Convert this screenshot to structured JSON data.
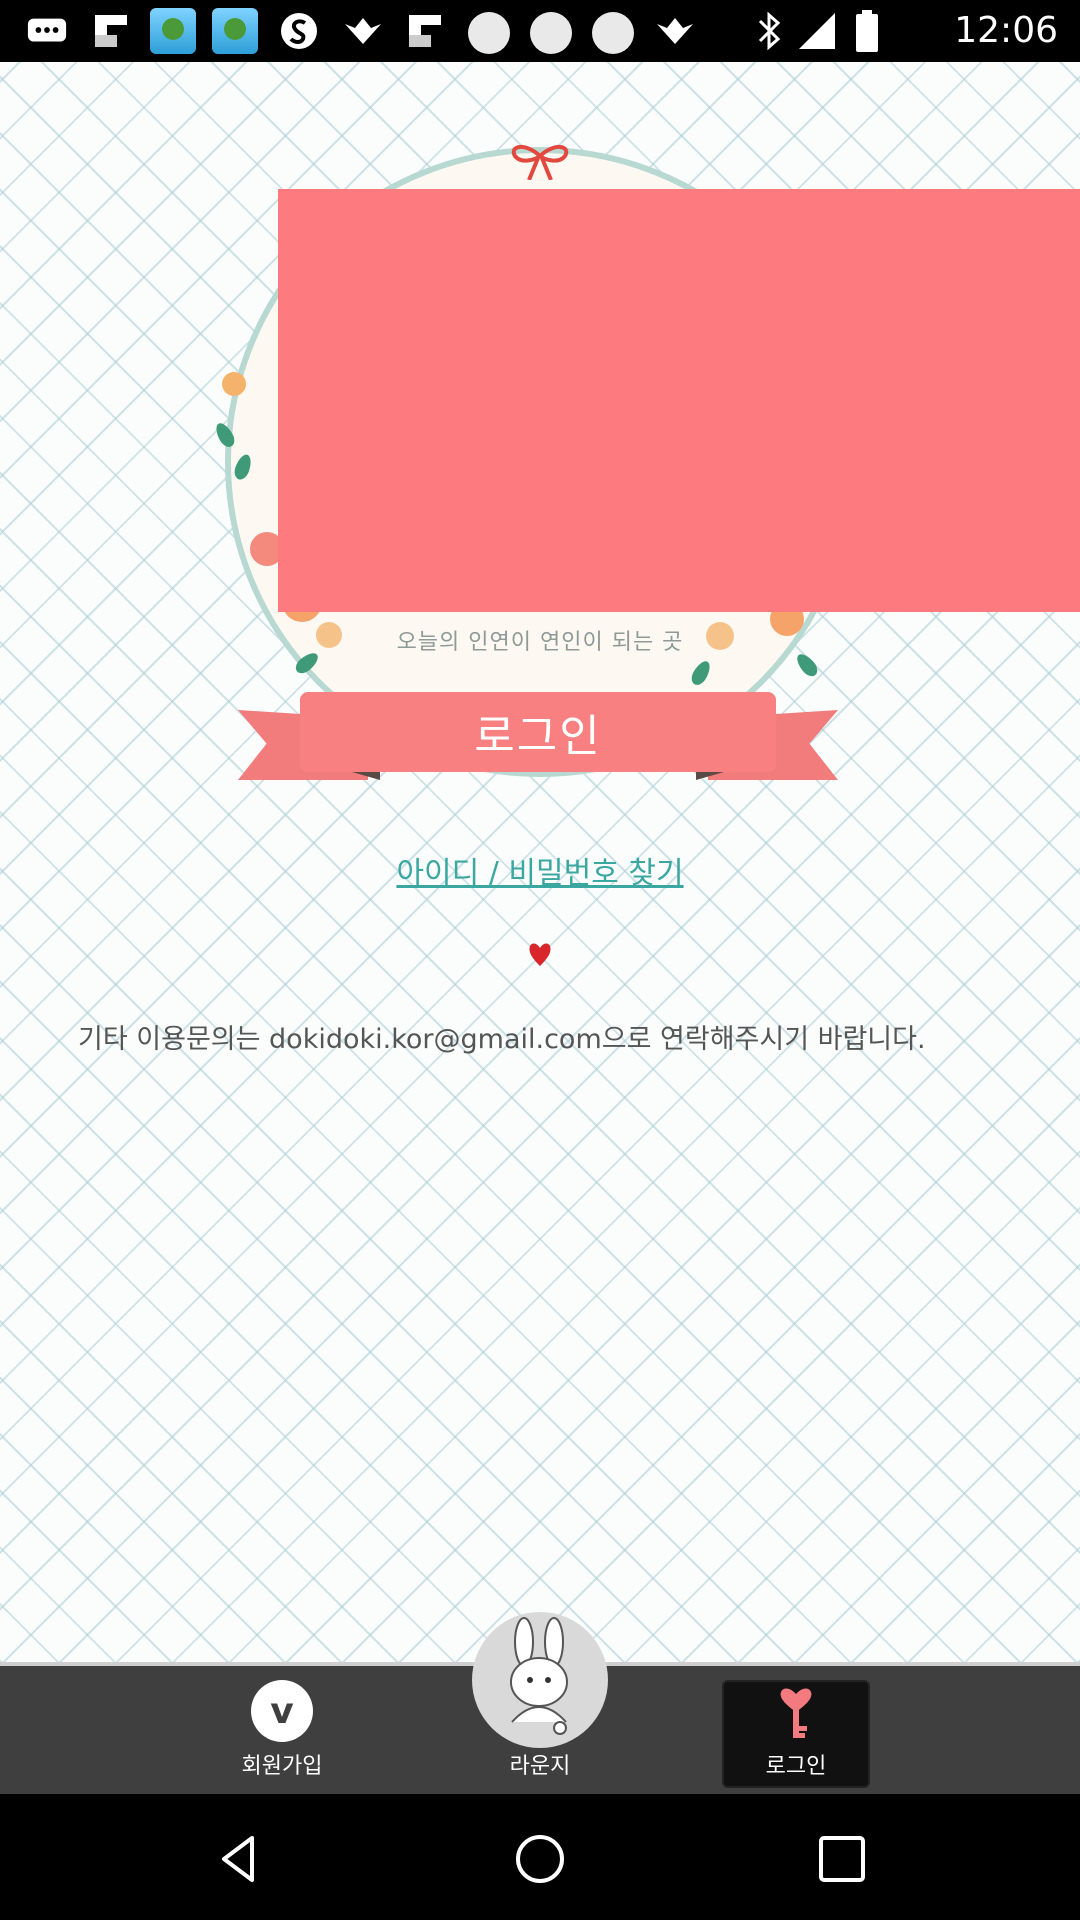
{
  "status_bar": {
    "time": "12:06",
    "icons": [
      "chat-icon",
      "flipboard-icon",
      "app-tree-icon",
      "app-tree-icon",
      "s-swirl-icon",
      "bird-icon",
      "flipboard-icon",
      "circle-icon",
      "circle-icon",
      "circle-icon",
      "bird-icon",
      "bluetooth-icon",
      "signal-icon",
      "battery-icon"
    ]
  },
  "main": {
    "tagline": "오늘의 인연이 연인이 되는 곳",
    "login_button": "로그인",
    "find_link": "아이디 / 비밀번호 찾기",
    "contact": "기타 이용문의는 dokidoki.kor@gmail.com으로 연락해주시기 바랍니다."
  },
  "colors": {
    "accent_pink": "#fd7b7e",
    "link_teal": "#3aa7a1",
    "tab_bar": "#3f3f3f"
  },
  "tabbar": {
    "signup_label": "회원가입",
    "lounge_label": "라운지",
    "login_label": "로그인"
  }
}
